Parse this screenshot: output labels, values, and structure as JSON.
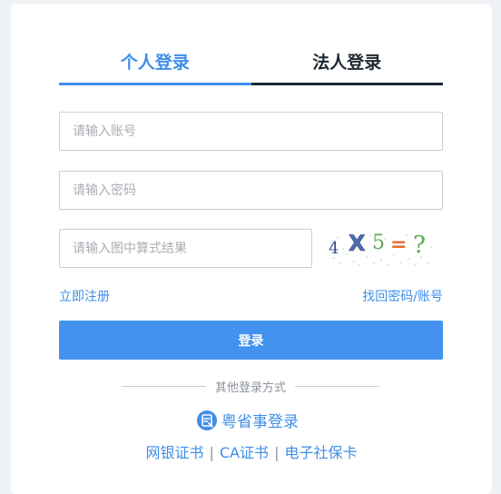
{
  "tabs": [
    {
      "label": "个人登录",
      "active": true
    },
    {
      "label": "法人登录",
      "active": false
    }
  ],
  "form": {
    "account_placeholder": "请输入账号",
    "password_placeholder": "请输入密码",
    "captcha_placeholder": "请输入图中算式结果",
    "captcha_text": "4 X 5 = ?"
  },
  "links": {
    "register": "立即注册",
    "forgot": "找回密码/账号"
  },
  "login_button": "登录",
  "other_methods_label": "其他登录方式",
  "ysx_login": "粤省事登录",
  "alt_logins": [
    "网银证书",
    "CA证书",
    "电子社保卡"
  ],
  "alt_separator": "|",
  "colors": {
    "accent": "#3f8ee8",
    "button": "#4392f0",
    "dark_tab": "#1e2833"
  },
  "icons": {
    "ysx": "ysx-logo-icon"
  }
}
